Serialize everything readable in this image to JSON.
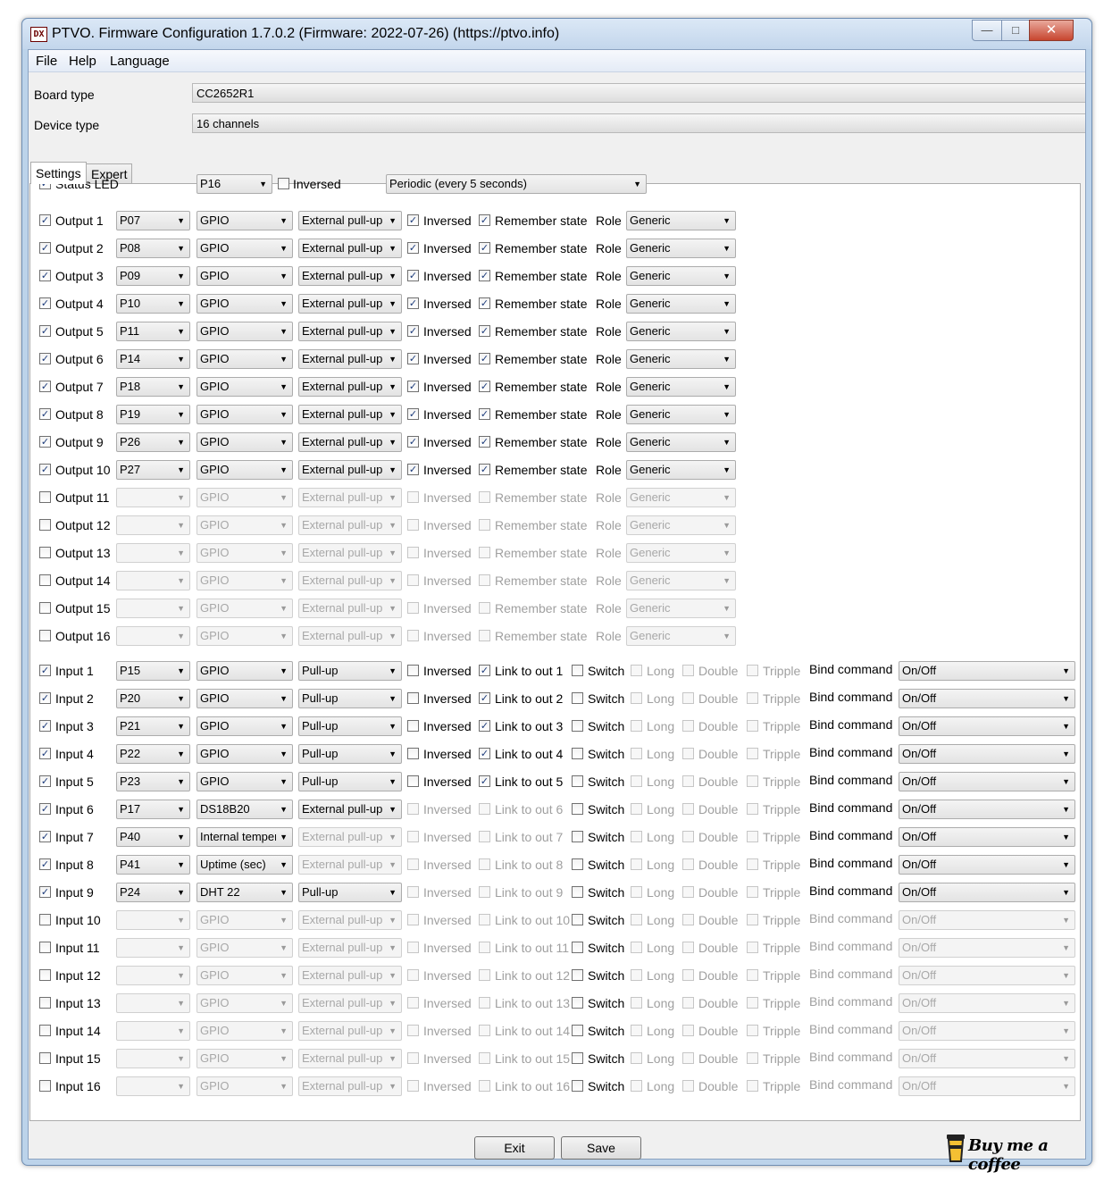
{
  "window": {
    "icon_text": "DX",
    "title": "PTVO. Firmware Configuration 1.7.0.2 (Firmware: 2022-07-26) (https://ptvo.info)"
  },
  "menu": [
    "File",
    "Help",
    "Language"
  ],
  "board": {
    "label": "Board type",
    "value": "CC2652R1"
  },
  "device": {
    "label": "Device type",
    "value": "16 channels"
  },
  "tabs": [
    "Settings",
    "Expert"
  ],
  "status_led": {
    "label": "Status LED",
    "checked": true,
    "pin": "P16",
    "inversed_label": "Inversed",
    "inversed": false,
    "mode": "Periodic (every 5 seconds)"
  },
  "outputs": [
    {
      "label": "Output 1",
      "enabled": true,
      "pin": "P07",
      "type": "GPIO",
      "pull": "External pull-up",
      "inversed": true,
      "remember": true,
      "role": "Generic"
    },
    {
      "label": "Output 2",
      "enabled": true,
      "pin": "P08",
      "type": "GPIO",
      "pull": "External pull-up",
      "inversed": true,
      "remember": true,
      "role": "Generic"
    },
    {
      "label": "Output 3",
      "enabled": true,
      "pin": "P09",
      "type": "GPIO",
      "pull": "External pull-up",
      "inversed": true,
      "remember": true,
      "role": "Generic"
    },
    {
      "label": "Output 4",
      "enabled": true,
      "pin": "P10",
      "type": "GPIO",
      "pull": "External pull-up",
      "inversed": true,
      "remember": true,
      "role": "Generic"
    },
    {
      "label": "Output 5",
      "enabled": true,
      "pin": "P11",
      "type": "GPIO",
      "pull": "External pull-up",
      "inversed": true,
      "remember": true,
      "role": "Generic"
    },
    {
      "label": "Output 6",
      "enabled": true,
      "pin": "P14",
      "type": "GPIO",
      "pull": "External pull-up",
      "inversed": true,
      "remember": true,
      "role": "Generic"
    },
    {
      "label": "Output 7",
      "enabled": true,
      "pin": "P18",
      "type": "GPIO",
      "pull": "External pull-up",
      "inversed": true,
      "remember": true,
      "role": "Generic"
    },
    {
      "label": "Output 8",
      "enabled": true,
      "pin": "P19",
      "type": "GPIO",
      "pull": "External pull-up",
      "inversed": true,
      "remember": true,
      "role": "Generic"
    },
    {
      "label": "Output 9",
      "enabled": true,
      "pin": "P26",
      "type": "GPIO",
      "pull": "External pull-up",
      "inversed": true,
      "remember": true,
      "role": "Generic"
    },
    {
      "label": "Output 10",
      "enabled": true,
      "pin": "P27",
      "type": "GPIO",
      "pull": "External pull-up",
      "inversed": true,
      "remember": true,
      "role": "Generic"
    },
    {
      "label": "Output 11",
      "enabled": false,
      "pin": "",
      "type": "GPIO",
      "pull": "External pull-up",
      "inversed": false,
      "remember": false,
      "role": "Generic"
    },
    {
      "label": "Output 12",
      "enabled": false,
      "pin": "",
      "type": "GPIO",
      "pull": "External pull-up",
      "inversed": false,
      "remember": false,
      "role": "Generic"
    },
    {
      "label": "Output 13",
      "enabled": false,
      "pin": "",
      "type": "GPIO",
      "pull": "External pull-up",
      "inversed": false,
      "remember": false,
      "role": "Generic"
    },
    {
      "label": "Output 14",
      "enabled": false,
      "pin": "",
      "type": "GPIO",
      "pull": "External pull-up",
      "inversed": false,
      "remember": false,
      "role": "Generic"
    },
    {
      "label": "Output 15",
      "enabled": false,
      "pin": "",
      "type": "GPIO",
      "pull": "External pull-up",
      "inversed": false,
      "remember": false,
      "role": "Generic"
    },
    {
      "label": "Output 16",
      "enabled": false,
      "pin": "",
      "type": "GPIO",
      "pull": "External pull-up",
      "inversed": false,
      "remember": false,
      "role": "Generic"
    }
  ],
  "output_labels": {
    "inversed": "Inversed",
    "remember": "Remember state",
    "role": "Role"
  },
  "inputs": [
    {
      "label": "Input 1",
      "enabled": true,
      "pin": "P15",
      "type": "GPIO",
      "pull": "Pull-up",
      "pull_enabled": true,
      "options_enabled": true,
      "inversed": false,
      "link": "Link to out 1",
      "link_checked": true,
      "bind": "On/Off",
      "bind_enabled": true
    },
    {
      "label": "Input 2",
      "enabled": true,
      "pin": "P20",
      "type": "GPIO",
      "pull": "Pull-up",
      "pull_enabled": true,
      "options_enabled": true,
      "inversed": false,
      "link": "Link to out 2",
      "link_checked": true,
      "bind": "On/Off",
      "bind_enabled": true
    },
    {
      "label": "Input 3",
      "enabled": true,
      "pin": "P21",
      "type": "GPIO",
      "pull": "Pull-up",
      "pull_enabled": true,
      "options_enabled": true,
      "inversed": false,
      "link": "Link to out 3",
      "link_checked": true,
      "bind": "On/Off",
      "bind_enabled": true
    },
    {
      "label": "Input 4",
      "enabled": true,
      "pin": "P22",
      "type": "GPIO",
      "pull": "Pull-up",
      "pull_enabled": true,
      "options_enabled": true,
      "inversed": false,
      "link": "Link to out 4",
      "link_checked": true,
      "bind": "On/Off",
      "bind_enabled": true
    },
    {
      "label": "Input 5",
      "enabled": true,
      "pin": "P23",
      "type": "GPIO",
      "pull": "Pull-up",
      "pull_enabled": true,
      "options_enabled": true,
      "inversed": false,
      "link": "Link to out 5",
      "link_checked": true,
      "bind": "On/Off",
      "bind_enabled": true
    },
    {
      "label": "Input 6",
      "enabled": true,
      "pin": "P17",
      "type": "DS18B20",
      "pull": "External pull-up",
      "pull_enabled": true,
      "options_enabled": false,
      "inversed": false,
      "link": "Link to out 6",
      "link_checked": false,
      "bind": "On/Off",
      "bind_enabled": true
    },
    {
      "label": "Input 7",
      "enabled": true,
      "pin": "P40",
      "type": "Internal temperature",
      "pull": "External pull-up",
      "pull_enabled": false,
      "options_enabled": false,
      "inversed": false,
      "link": "Link to out 7",
      "link_checked": false,
      "bind": "On/Off",
      "bind_enabled": true
    },
    {
      "label": "Input 8",
      "enabled": true,
      "pin": "P41",
      "type": "Uptime (sec)",
      "pull": "External pull-up",
      "pull_enabled": false,
      "options_enabled": false,
      "inversed": false,
      "link": "Link to out 8",
      "link_checked": false,
      "bind": "On/Off",
      "bind_enabled": true
    },
    {
      "label": "Input 9",
      "enabled": true,
      "pin": "P24",
      "type": "DHT 22",
      "pull": "Pull-up",
      "pull_enabled": true,
      "options_enabled": false,
      "inversed": false,
      "link": "Link to out 9",
      "link_checked": false,
      "bind": "On/Off",
      "bind_enabled": true
    },
    {
      "label": "Input 10",
      "enabled": false,
      "pin": "",
      "type": "GPIO",
      "pull": "External pull-up",
      "pull_enabled": false,
      "options_enabled": false,
      "inversed": false,
      "link": "Link to out 10",
      "link_checked": false,
      "bind": "On/Off",
      "bind_enabled": false
    },
    {
      "label": "Input 11",
      "enabled": false,
      "pin": "",
      "type": "GPIO",
      "pull": "External pull-up",
      "pull_enabled": false,
      "options_enabled": false,
      "inversed": false,
      "link": "Link to out 11",
      "link_checked": false,
      "bind": "On/Off",
      "bind_enabled": false
    },
    {
      "label": "Input 12",
      "enabled": false,
      "pin": "",
      "type": "GPIO",
      "pull": "External pull-up",
      "pull_enabled": false,
      "options_enabled": false,
      "inversed": false,
      "link": "Link to out 12",
      "link_checked": false,
      "bind": "On/Off",
      "bind_enabled": false
    },
    {
      "label": "Input 13",
      "enabled": false,
      "pin": "",
      "type": "GPIO",
      "pull": "External pull-up",
      "pull_enabled": false,
      "options_enabled": false,
      "inversed": false,
      "link": "Link to out 13",
      "link_checked": false,
      "bind": "On/Off",
      "bind_enabled": false
    },
    {
      "label": "Input 14",
      "enabled": false,
      "pin": "",
      "type": "GPIO",
      "pull": "External pull-up",
      "pull_enabled": false,
      "options_enabled": false,
      "inversed": false,
      "link": "Link to out 14",
      "link_checked": false,
      "bind": "On/Off",
      "bind_enabled": false
    },
    {
      "label": "Input 15",
      "enabled": false,
      "pin": "",
      "type": "GPIO",
      "pull": "External pull-up",
      "pull_enabled": false,
      "options_enabled": false,
      "inversed": false,
      "link": "Link to out 15",
      "link_checked": false,
      "bind": "On/Off",
      "bind_enabled": false
    },
    {
      "label": "Input 16",
      "enabled": false,
      "pin": "",
      "type": "GPIO",
      "pull": "External pull-up",
      "pull_enabled": false,
      "options_enabled": false,
      "inversed": false,
      "link": "Link to out 16",
      "link_checked": false,
      "bind": "On/Off",
      "bind_enabled": false
    }
  ],
  "input_labels": {
    "inversed": "Inversed",
    "switch": "Switch",
    "long": "Long",
    "double": "Double",
    "tripple": "Tripple",
    "bind": "Bind command"
  },
  "buttons": {
    "exit": "Exit",
    "save": "Save"
  },
  "coffee": {
    "text": "Buy me a coffee"
  },
  "colors": {
    "titlebar": "#c3d6ec",
    "disabled_text": "#a0a0a0",
    "check_mark": "#1b3a7a",
    "close_button": "#c7452f"
  }
}
